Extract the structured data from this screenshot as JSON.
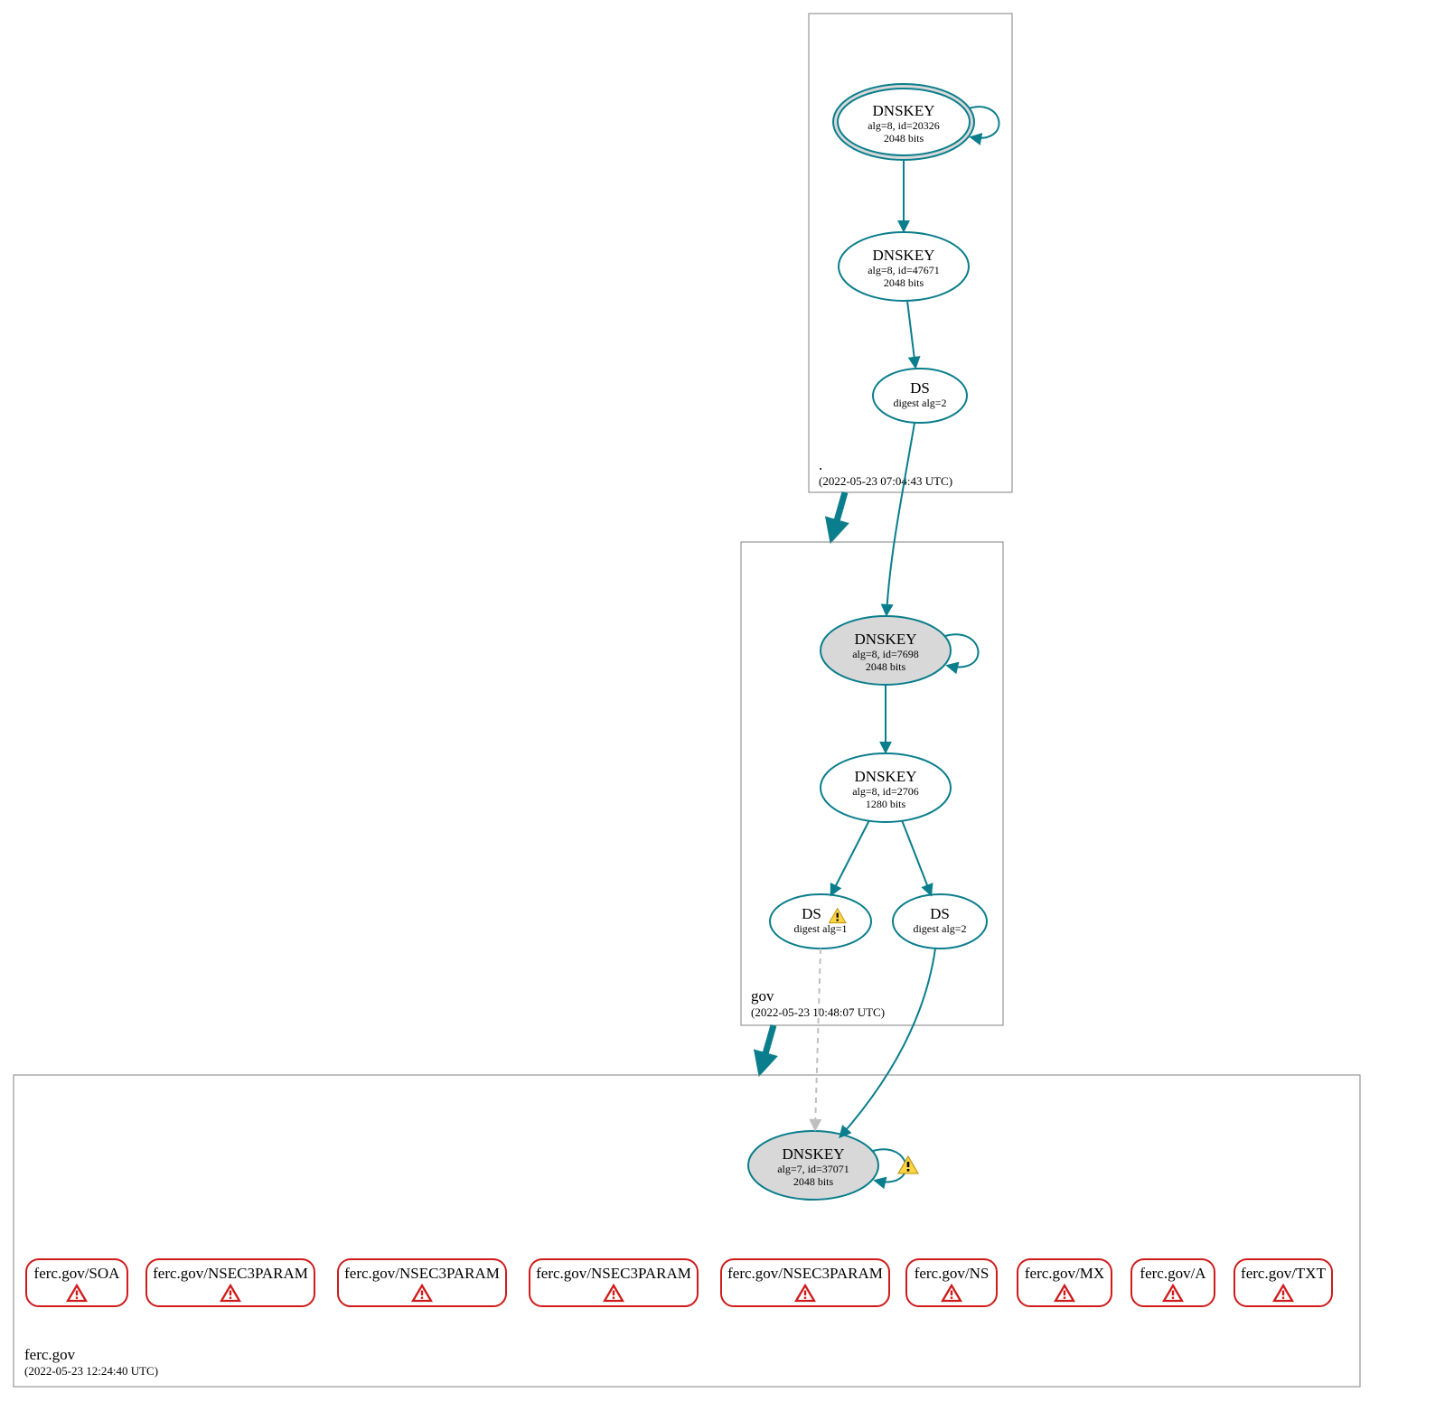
{
  "colors": {
    "teal": "#0a7e8c",
    "red": "#cf1b1b",
    "grey_fill": "#d8d8d8",
    "box_grey": "#808080"
  },
  "zones": {
    "root": {
      "name": ".",
      "timestamp": "(2022-05-23 07:04:43 UTC)",
      "nodes": {
        "ksk": {
          "title": "DNSKEY",
          "sub1": "alg=8, id=20326",
          "sub2": "2048 bits"
        },
        "zsk": {
          "title": "DNSKEY",
          "sub1": "alg=8, id=47671",
          "sub2": "2048 bits"
        },
        "ds": {
          "title": "DS",
          "sub1": "digest alg=2"
        }
      }
    },
    "gov": {
      "name": "gov",
      "timestamp": "(2022-05-23 10:48:07 UTC)",
      "nodes": {
        "ksk": {
          "title": "DNSKEY",
          "sub1": "alg=8, id=7698",
          "sub2": "2048 bits"
        },
        "zsk": {
          "title": "DNSKEY",
          "sub1": "alg=8, id=2706",
          "sub2": "1280 bits"
        },
        "ds1": {
          "title": "DS",
          "sub1": "digest alg=1"
        },
        "ds2": {
          "title": "DS",
          "sub1": "digest alg=2"
        }
      }
    },
    "ferc": {
      "name": "ferc.gov",
      "timestamp": "(2022-05-23 12:24:40 UTC)",
      "nodes": {
        "ksk": {
          "title": "DNSKEY",
          "sub1": "alg=7, id=37071",
          "sub2": "2048 bits"
        }
      },
      "records": [
        "ferc.gov/SOA",
        "ferc.gov/NSEC3PARAM",
        "ferc.gov/NSEC3PARAM",
        "ferc.gov/NSEC3PARAM",
        "ferc.gov/NSEC3PARAM",
        "ferc.gov/NS",
        "ferc.gov/MX",
        "ferc.gov/A",
        "ferc.gov/TXT"
      ]
    }
  }
}
